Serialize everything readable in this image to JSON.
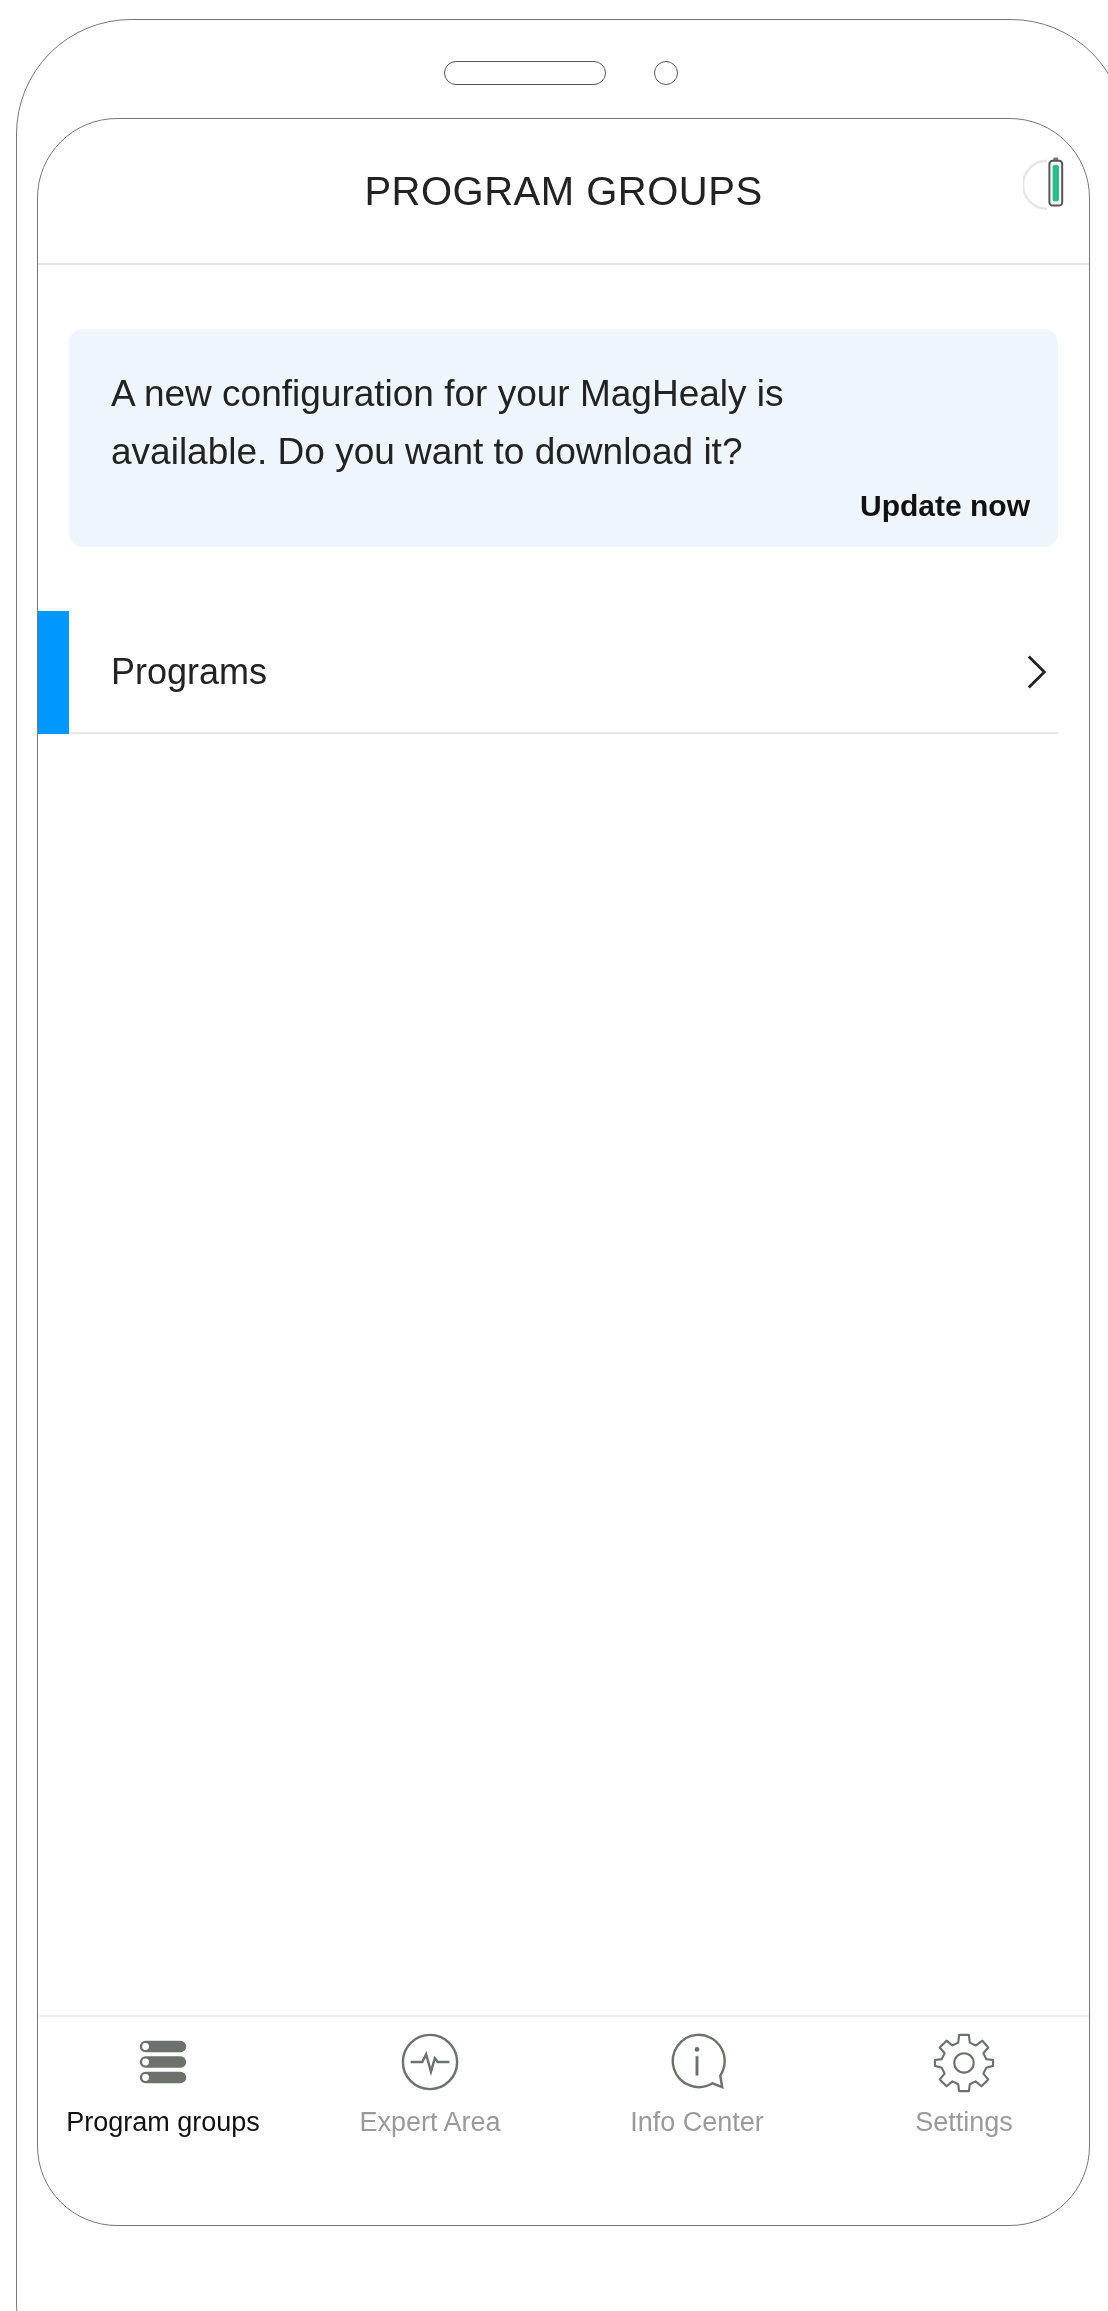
{
  "header": {
    "title": "PROGRAM GROUPS"
  },
  "banner": {
    "message": "A new configuration for your MagHealy is available. Do you want to download it?",
    "action": "Update now"
  },
  "list": [
    {
      "label": "Programs",
      "selected": true
    }
  ],
  "nav": [
    {
      "kind": "groups",
      "label": "Program groups",
      "selected": true
    },
    {
      "kind": "pulse",
      "label": "Expert Area",
      "selected": false
    },
    {
      "kind": "info",
      "label": "Info Center",
      "selected": false
    },
    {
      "kind": "gear",
      "label": "Settings",
      "selected": false
    }
  ]
}
